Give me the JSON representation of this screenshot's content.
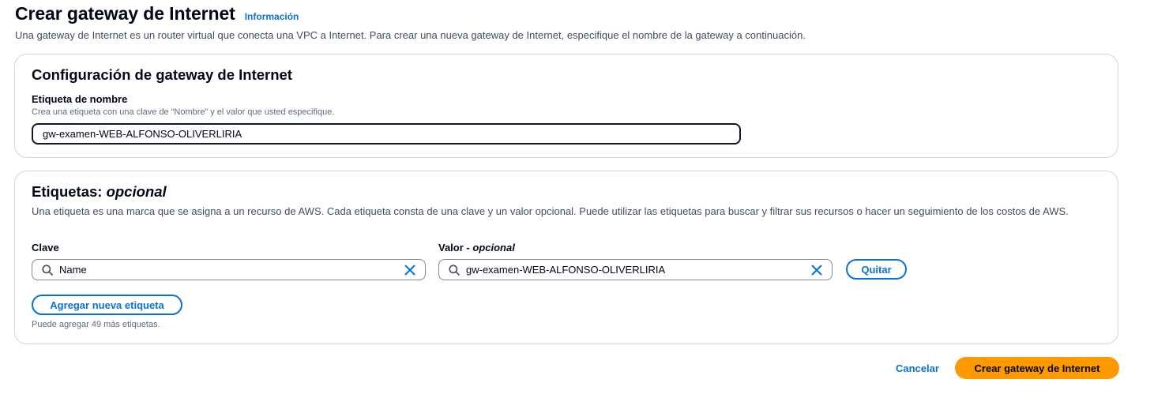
{
  "header": {
    "title": "Crear gateway de Internet",
    "info_link": "Información",
    "description": "Una gateway de Internet es un router virtual que conecta una VPC a Internet. Para crear una nueva gateway de Internet, especifique el nombre de la gateway a continuación."
  },
  "config_panel": {
    "title": "Configuración de gateway de Internet",
    "name_label": "Etiqueta de nombre",
    "name_hint": "Crea una etiqueta con una clave de “Nombre” y el valor que usted especifique.",
    "name_value": "gw-examen-WEB-ALFONSO-OLIVERLIRIA"
  },
  "tags_panel": {
    "title": "Etiquetas:",
    "title_optional": "opcional",
    "description": "Una etiqueta es una marca que se asigna a un recurso de AWS. Cada etiqueta consta de una clave y un valor opcional. Puede utilizar las etiquetas para buscar y filtrar sus recursos o hacer un seguimiento de los costos de AWS.",
    "key_label": "Clave",
    "value_label": "Valor -",
    "value_label_optional": "opcional",
    "tags": [
      {
        "key": "Name",
        "value": "gw-examen-WEB-ALFONSO-OLIVERLIRIA",
        "remove_label": "Quitar"
      }
    ],
    "add_tag_label": "Agregar nueva etiqueta",
    "remaining_hint": "Puede agregar 49 más etiquetas."
  },
  "footer": {
    "cancel_label": "Cancelar",
    "create_label": "Crear gateway de Internet"
  },
  "icons": {
    "search": "search-icon",
    "clear": "close-icon"
  },
  "colors": {
    "link": "#0972d3",
    "primary_button": "#ff9900",
    "text": "#000716",
    "secondary_text": "#414d5c"
  }
}
